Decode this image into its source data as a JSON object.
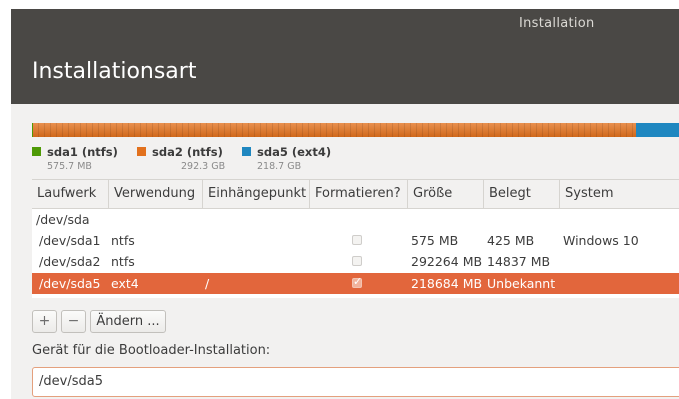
{
  "window": {
    "title": "Installation"
  },
  "page": {
    "title": "Installationsart"
  },
  "legend": [
    {
      "name": "sda1 (ntfs)",
      "size": "575.7 MB",
      "color": "#4e9a06"
    },
    {
      "name": "sda2 (ntfs)",
      "size": "292.3 GB",
      "color": "#e2711d"
    },
    {
      "name": "sda5 (ext4)",
      "size": "218.7 GB",
      "color": "#1f87c0"
    }
  ],
  "table": {
    "headers": [
      "Laufwerk",
      "Verwendung",
      "Einhängepunkt",
      "Formatieren?",
      "Größe",
      "Belegt",
      "System"
    ],
    "rows": [
      {
        "device": "/dev/sda",
        "use": "",
        "mount": "",
        "format": null,
        "size": "",
        "used": "",
        "system": ""
      },
      {
        "device": "/dev/sda1",
        "use": "ntfs",
        "mount": "",
        "format": false,
        "size": "575 MB",
        "used": "425 MB",
        "system": "Windows 10"
      },
      {
        "device": "/dev/sda2",
        "use": "ntfs",
        "mount": "",
        "format": false,
        "size": "292264 MB",
        "used": "14837 MB",
        "system": ""
      },
      {
        "device": "/dev/sda5",
        "use": "ext4",
        "mount": "/",
        "format": true,
        "size": "218684 MB",
        "used": "Unbekannt",
        "system": "",
        "selected": true
      }
    ]
  },
  "buttons": {
    "add": "+",
    "remove": "−",
    "change": "Ändern ..."
  },
  "bootloader": {
    "label": "Gerät für die Bootloader-Installation:",
    "value": "/dev/sda5"
  },
  "colors": {
    "accent": "#e2663c",
    "titlebar": "#4a4845"
  }
}
